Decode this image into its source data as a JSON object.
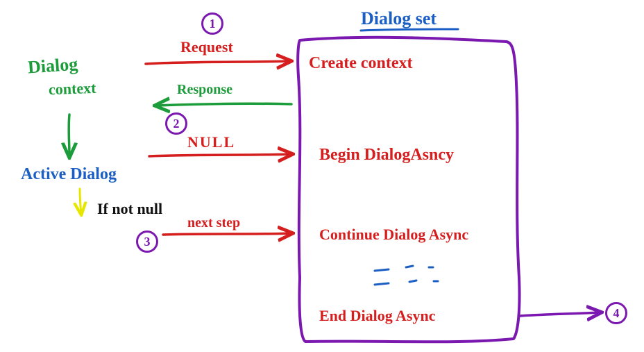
{
  "title": "Dialog set",
  "left": {
    "dialog_context_line1": "Dialog",
    "dialog_context_line2": "context",
    "active_dialog": "Active Dialog",
    "if_not_null": "If not null"
  },
  "arrows": {
    "request": "Request",
    "response": "Response",
    "null": "NULL",
    "next_step": "next step"
  },
  "box": {
    "create_context": "Create context",
    "begin_dialog": "Begin DialogAsncy",
    "continue_dialog": "Continue Dialog Async",
    "end_dialog": "End Dialog Async"
  },
  "markers": {
    "m1": "1",
    "m2": "2",
    "m3": "3",
    "m4": "4"
  },
  "colors": {
    "red": "#d51f1f",
    "green": "#1c9c3a",
    "blue": "#1b5fc5",
    "purple": "#7a18b0",
    "black": "#111111",
    "yellow": "#e6e600"
  }
}
